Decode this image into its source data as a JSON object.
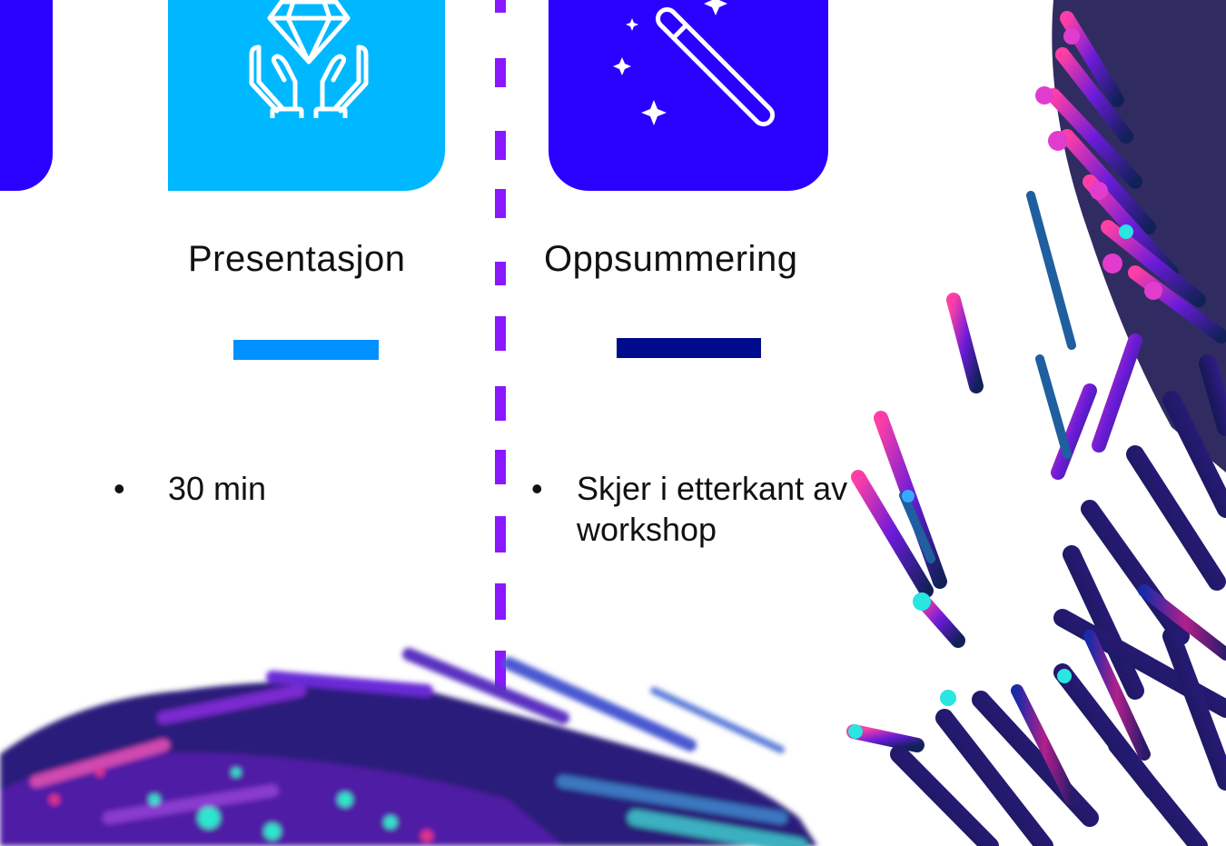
{
  "columns": [
    {
      "title": "Presentasjon",
      "icon": "diamond-in-hands-icon",
      "tile_color": "#00b8ff",
      "bar_color": "#0090ff",
      "bullets": [
        "30 min"
      ]
    },
    {
      "title": "Oppsummering",
      "icon": "magic-wand-icon",
      "tile_color": "#2a00ff",
      "bar_color": "#000a8c",
      "bullets": [
        "Skjer i etterkant av workshop"
      ]
    }
  ],
  "bullet_glyph": "•",
  "divider_color": "#8a18ff",
  "decoration": "abstract-fiber-artwork"
}
